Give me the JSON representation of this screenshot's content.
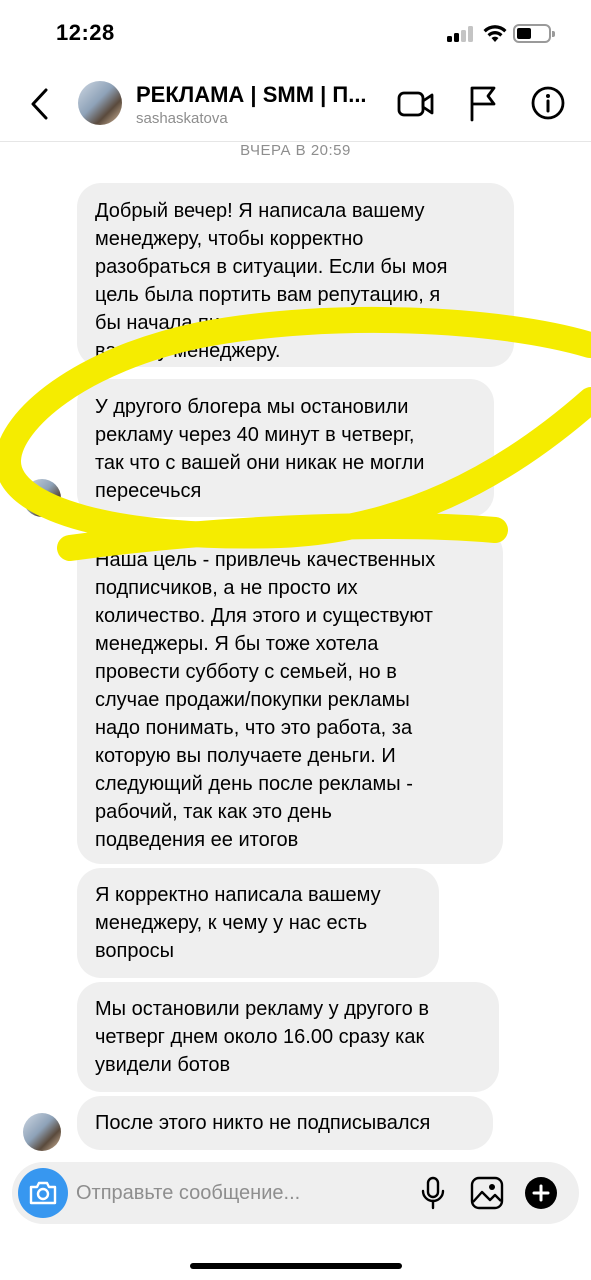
{
  "status_bar": {
    "time": "12:28",
    "signal_bars": 4,
    "signal_active": 2,
    "battery_level": 0.4
  },
  "header": {
    "title": "РЕКЛАМА | SMM | П...",
    "username": "sashaskatova",
    "icons": [
      "chevron-left-icon",
      "video-camera-icon",
      "flag-icon",
      "info-icon"
    ]
  },
  "conversation": {
    "timestamp": "ВЧЕРА В 20:59",
    "messages": [
      {
        "text": "Добрый вечер! Я написала вашему\nменеджеру, чтобы корректно\nразобраться в ситуации. Если бы моя\nцель была портить вам репутацию, я\nбы начала писать в чатах, а не\nвашему менеджеру."
      },
      {
        "text": "У другого блогера мы остановили\nрекламу через 40 минут в четверг,\nтак что с вашей они никак не могли\nпересечься"
      },
      {
        "text": "Наша цель - привлечь качественных\nподписчиков, а не просто их\nколичество. Для этого и существуют\nменеджеры. Я бы тоже хотела\nпровести субботу с семьей, но в\nслучае продажи/покупки рекламы\nнадо понимать, что это работа, за\nкоторую вы получаете деньги. И\nследующий день после рекламы -\nрабочий, так как это день\nподведения ее итогов"
      },
      {
        "text": "Я корректно написала вашему\nменеджеру, к чему у нас есть\nвопросы"
      },
      {
        "text": "Мы остановили рекламу у другого в\nчетверг днем около 16.00 сразу как\nувидели ботов"
      },
      {
        "text": "После этого никто не подписывался"
      }
    ]
  },
  "annotation": {
    "color": "#f5ec00"
  },
  "composer": {
    "placeholder": "Отправьте сообщение...",
    "accent": "#3797f0"
  }
}
